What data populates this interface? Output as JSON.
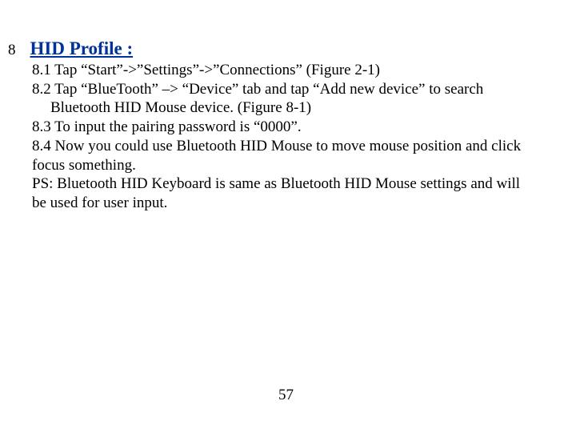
{
  "heading": {
    "section_number": "8",
    "title": "HID Profile :"
  },
  "body": {
    "line1": "8.1 Tap “Start”->”Settings”->”Connections” (Figure 2-1)",
    "line2": "8.2 Tap “BlueTooth” –> “Device” tab and tap “Add new device” to search",
    "line3": "Bluetooth HID Mouse device. (Figure 8-1)",
    "line4": "8.3 To input the pairing password is “0000”.",
    "line5": "8.4 Now you could use Bluetooth HID Mouse to move mouse position and click",
    "line5b": "focus something.",
    "line6": "PS: Bluetooth HID Keyboard is same as Bluetooth HID Mouse settings and will",
    "line6b": "be used for user input."
  },
  "page_number": "57"
}
